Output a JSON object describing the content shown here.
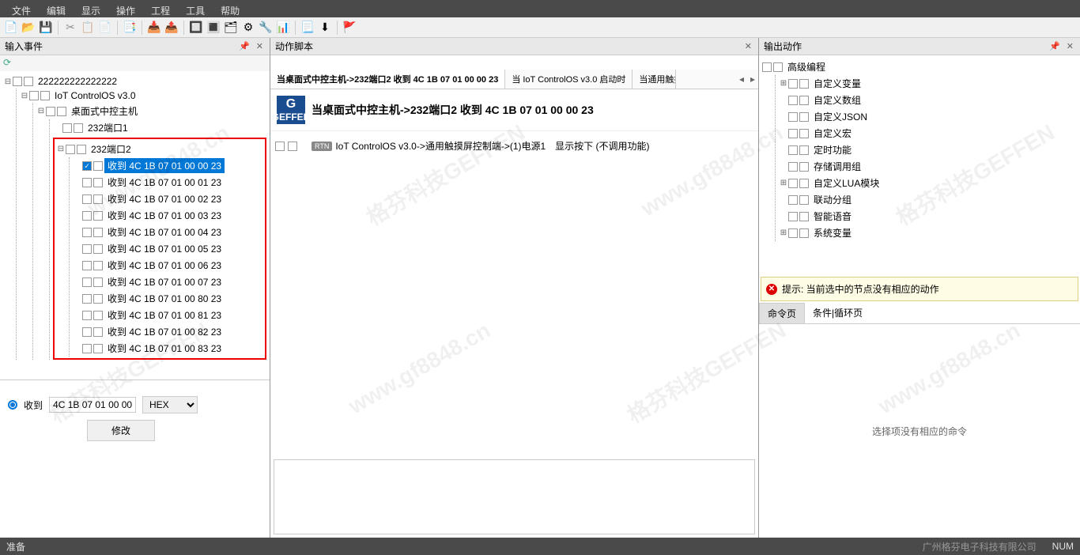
{
  "menubar": [
    "文件",
    "编辑",
    "显示",
    "操作",
    "工程",
    "工具",
    "帮助"
  ],
  "left": {
    "title": "输入事件",
    "tree_root": "222222222222222",
    "iot": "IoT ControlOS v3.0",
    "desktop": "桌面式中控主机",
    "port1": "232端口1",
    "port2": "232端口2",
    "events": [
      "收到 4C 1B 07 01 00 00 23",
      "收到 4C 1B 07 01 00 01 23",
      "收到 4C 1B 07 01 00 02 23",
      "收到 4C 1B 07 01 00 03 23",
      "收到 4C 1B 07 01 00 04 23",
      "收到 4C 1B 07 01 00 05 23",
      "收到 4C 1B 07 01 00 06 23",
      "收到 4C 1B 07 01 00 07 23",
      "收到 4C 1B 07 01 00 80 23",
      "收到 4C 1B 07 01 00 81 23",
      "收到 4C 1B 07 01 00 82 23",
      "收到 4C 1B 07 01 00 83 23"
    ],
    "form": {
      "recv_label": "收到",
      "hex_value": "4C 1B 07 01 00 00",
      "format": "HEX",
      "modify_btn": "修改"
    }
  },
  "center": {
    "title": "动作脚本",
    "tabs": [
      "当桌面式中控主机->232端口2 收到 4C 1B 07 01 00 00 23",
      "当 IoT ControlOS v3.0 启动时",
      "当通用触摸"
    ],
    "script_title": "当桌面式中控主机->232端口2 收到 4C 1B 07 01 00 00 23",
    "logo_text": "GEFFEN",
    "script_line_badge": "RTN",
    "script_line": "IoT ControlOS v3.0->通用触摸屏控制端->(1)电源1　显示按下 (不调用功能)"
  },
  "right": {
    "title": "输出动作",
    "tree": [
      {
        "label": "高级编程",
        "children": [
          "自定义变量",
          "自定义数组",
          "自定义JSON",
          "自定义宏",
          "定时功能",
          "存储调用组",
          "自定义LUA模块",
          "联动分组",
          "智能语音",
          "系统变量"
        ]
      }
    ],
    "warning": "提示: 当前选中的节点没有相应的动作",
    "cmd_tabs": [
      "命令页",
      "条件|循环页"
    ],
    "cmd_empty": "选择项没有相应的命令"
  },
  "statusbar": {
    "left": "准备",
    "company": "广州格芬电子科技有限公司",
    "num": "NUM"
  }
}
